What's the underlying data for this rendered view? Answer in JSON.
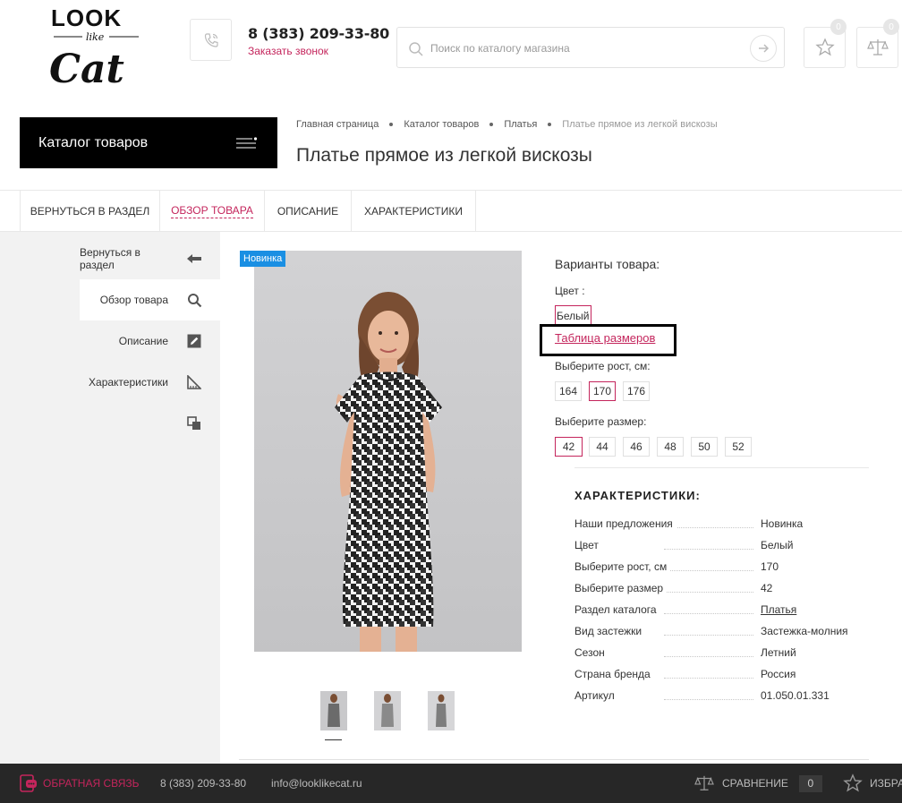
{
  "header": {
    "logo_text": "LOOK like Cat",
    "phone": "8 (383) 209-33-80",
    "callback_label": "Заказать звонок",
    "search_placeholder": "Поиск по каталогу магазина",
    "favorites_count": "0",
    "compare_count": "0"
  },
  "catalog_button": "Каталог товаров",
  "breadcrumb": [
    "Главная страница",
    "Каталог товаров",
    "Платья",
    "Платье прямое из легкой вискозы"
  ],
  "page_title": "Платье прямое из легкой вискозы",
  "tabs": [
    {
      "label": "ВЕРНУТЬСЯ В РАЗДЕЛ"
    },
    {
      "label": "ОБЗОР ТОВАРА"
    },
    {
      "label": "ОПИСАНИЕ"
    },
    {
      "label": "ХАРАКТЕРИСТИКИ"
    }
  ],
  "sidebar": [
    {
      "label": "Вернуться в раздел",
      "icon": "arrow-left-icon"
    },
    {
      "label": "Обзор товара",
      "icon": "search-icon"
    },
    {
      "label": "Описание",
      "icon": "edit-icon"
    },
    {
      "label": "Характеристики",
      "icon": "ruler-icon"
    },
    {
      "label": "",
      "icon": "copy-icon"
    }
  ],
  "product": {
    "badge": "Новинка",
    "variants_title": "Варианты товара:",
    "color_label": "Цвет :",
    "color_value": "Белый",
    "size_table_link": "Таблица размеров",
    "height_label": "Выберите рост, см:",
    "heights": [
      "164",
      "170",
      "176"
    ],
    "selected_height": "170",
    "size_label": "Выберите размер:",
    "sizes": [
      "42",
      "44",
      "46",
      "48",
      "50",
      "52"
    ],
    "selected_size": "42"
  },
  "characteristics": {
    "title": "ХАРАКТЕРИСТИКИ:",
    "rows": [
      {
        "key": "Наши предложения",
        "value": "Новинка"
      },
      {
        "key": "Цвет",
        "value": "Белый"
      },
      {
        "key": "Выберите рост, см",
        "value": "170"
      },
      {
        "key": "Выберите размер",
        "value": "42"
      },
      {
        "key": "Раздел каталога",
        "value": "Платья"
      },
      {
        "key": "Вид застежки",
        "value": "Застежка-молния"
      },
      {
        "key": "Сезон",
        "value": "Летний"
      },
      {
        "key": "Страна бренда",
        "value": "Россия"
      },
      {
        "key": "Артикул",
        "value": "01.050.01.331"
      }
    ]
  },
  "footer": {
    "feedback": "ОБРАТНАЯ СВЯЗЬ",
    "phone": "8 (383) 209-33-80",
    "email": "info@looklikecat.ru",
    "compare_label": "СРАВНЕНИЕ",
    "compare_count": "0",
    "favorites_label": "ИЗБРАННОЕ"
  },
  "colors": {
    "accent": "#c4255c",
    "badge_blue": "#1a8fe3",
    "footer_bg": "#272727",
    "sidebar_bg": "#f2f2f2"
  }
}
